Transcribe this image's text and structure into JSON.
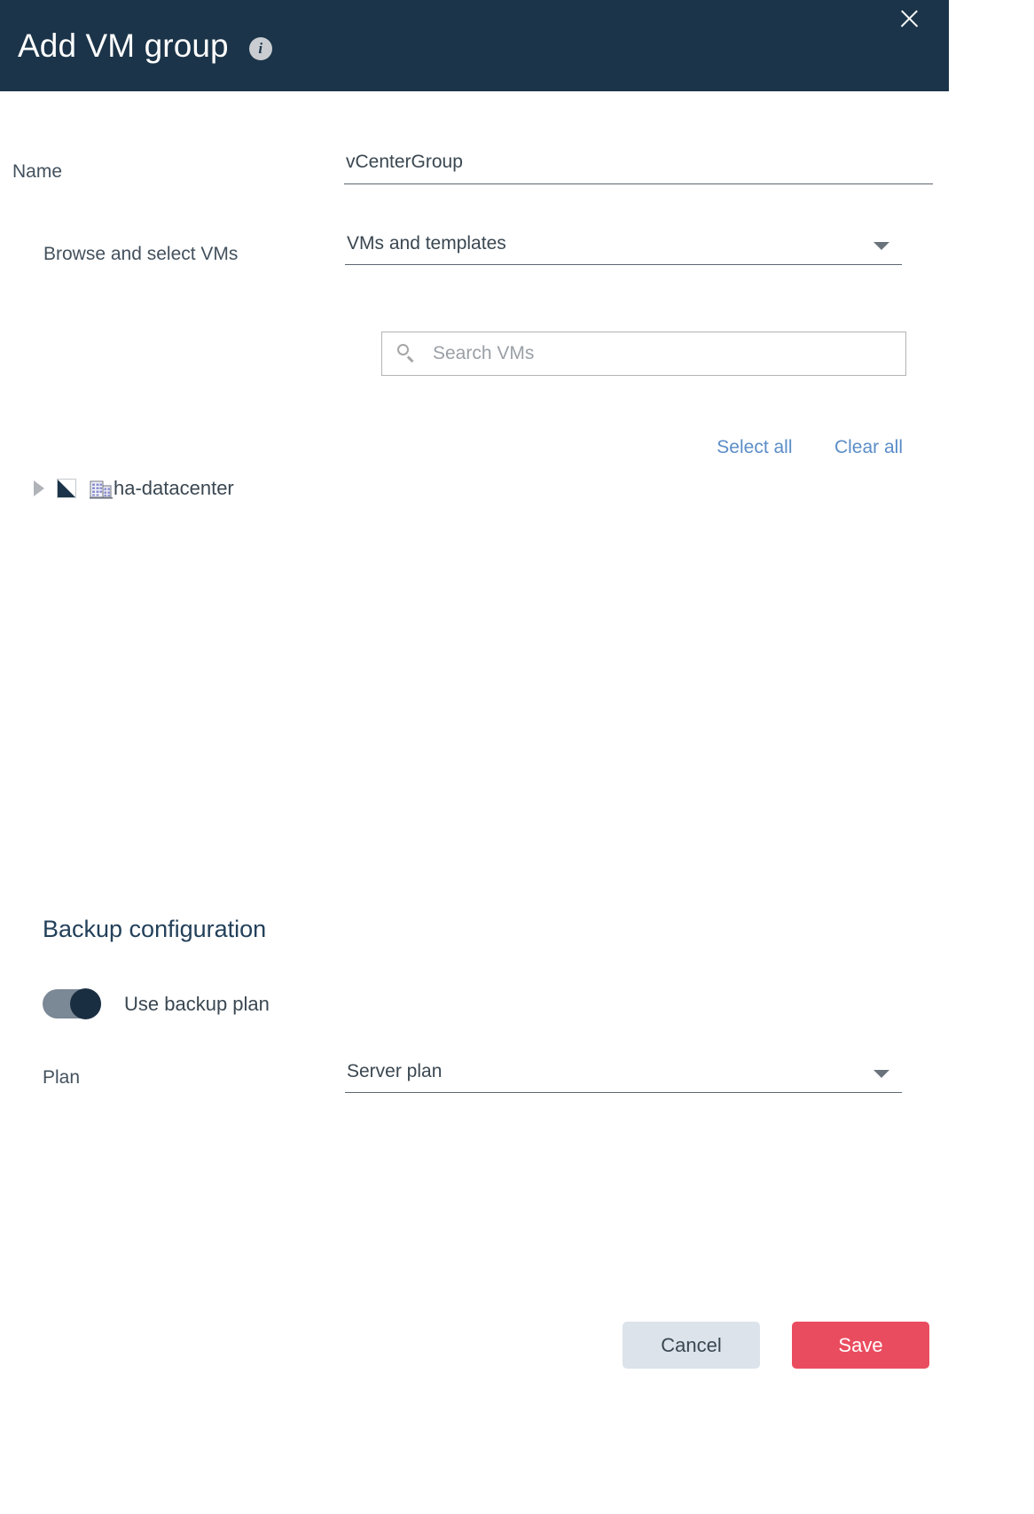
{
  "dialog": {
    "title": "Add VM group",
    "info_icon": "info-icon",
    "close_icon": "close-icon"
  },
  "form": {
    "name": {
      "label": "Name",
      "value": "vCenterGroup",
      "placeholder": ""
    },
    "browse": {
      "label": "Browse and select VMs",
      "value": "VMs and templates",
      "options": [
        "VMs and templates"
      ]
    },
    "search": {
      "placeholder": "Search VMs",
      "value": "",
      "icon": "search-icon"
    },
    "links": {
      "select_all": "Select all",
      "clear_all": "Clear all"
    },
    "tree": [
      {
        "label": "ha-datacenter",
        "expanded": false,
        "checkbox_state": "partial",
        "icon": "datacenter-icon",
        "arrow_icon": "triangle-right-icon"
      }
    ]
  },
  "backup": {
    "section_title": "Backup configuration",
    "toggle": {
      "label": "Use backup plan",
      "state": "on"
    },
    "plan": {
      "label": "Plan",
      "value": "Server plan",
      "options": [
        "Server plan"
      ]
    }
  },
  "footer": {
    "cancel_label": "Cancel",
    "save_label": "Save"
  },
  "colors": {
    "header_bg": "#1b3449",
    "accent_link": "#5b8dc8",
    "save_bg": "#ea4c5f",
    "cancel_bg": "#dce3ea",
    "toggle_knob": "#1a2e42",
    "toggle_track": "#7b8895"
  }
}
